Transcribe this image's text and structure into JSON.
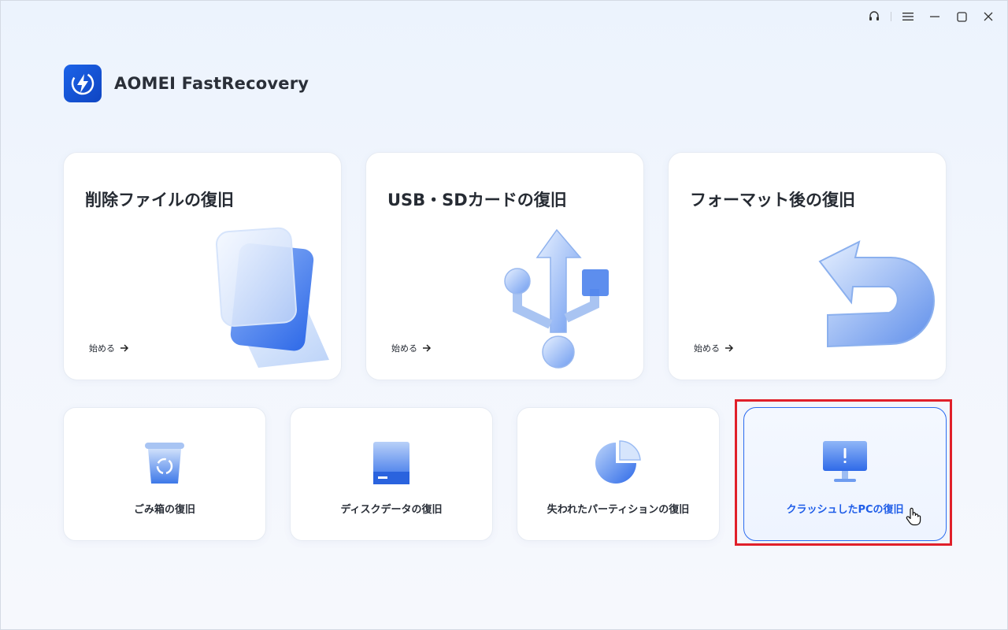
{
  "app": {
    "title": "AOMEI FastRecovery"
  },
  "window_controls": [
    "support-headset",
    "menu",
    "minimize",
    "maximize",
    "close"
  ],
  "cards_large": [
    {
      "title": "削除ファイルの復旧",
      "action": "始める",
      "illustration": "file-stack"
    },
    {
      "title": "USB・SDカードの復旧",
      "action": "始める",
      "illustration": "usb-symbol"
    },
    {
      "title": "フォーマット後の復旧",
      "action": "始める",
      "illustration": "return-arrow"
    }
  ],
  "cards_small": [
    {
      "label": "ごみ箱の復旧",
      "icon": "recycle-bin"
    },
    {
      "label": "ディスクデータの復旧",
      "icon": "hard-disk"
    },
    {
      "label": "失われたパーティションの復旧",
      "icon": "pie-partition"
    },
    {
      "label": "クラッシュしたPCの復旧",
      "icon": "monitor-alert",
      "selected": true
    }
  ],
  "colors": {
    "accent": "#1f5de8",
    "highlight": "#e0202a",
    "logo_bg": "#1c63e8"
  }
}
